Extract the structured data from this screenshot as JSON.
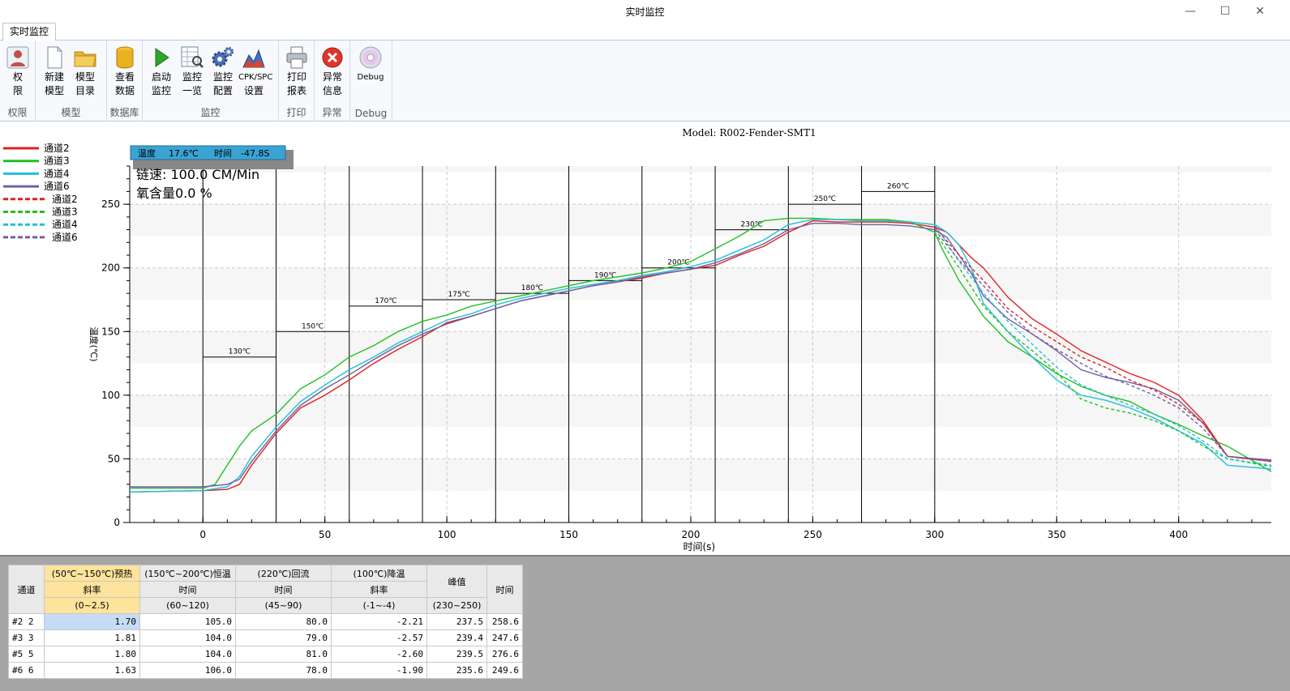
{
  "window": {
    "title": "实时监控",
    "min": "—",
    "max": "☐",
    "close": "✕"
  },
  "tab": {
    "label": "实时监控"
  },
  "ribbon": {
    "groups": [
      {
        "label": "权限",
        "buttons": [
          {
            "label1": "权",
            "label2": "限",
            "icon": "user-lock-icon"
          }
        ]
      },
      {
        "label": "模型",
        "buttons": [
          {
            "label1": "新建",
            "label2": "模型",
            "icon": "new-file-icon"
          },
          {
            "label1": "模型",
            "label2": "目录",
            "icon": "folder-icon"
          }
        ]
      },
      {
        "label": "数据库",
        "buttons": [
          {
            "label1": "查看",
            "label2": "数据",
            "icon": "database-icon"
          }
        ]
      },
      {
        "label": "监控",
        "buttons": [
          {
            "label1": "启动",
            "label2": "监控",
            "icon": "play-icon"
          },
          {
            "label1": "监控",
            "label2": "一览",
            "icon": "table-search-icon"
          },
          {
            "label1": "监控",
            "label2": "配置",
            "icon": "gears-icon"
          },
          {
            "label1": "CPK/SPC",
            "label2": "设置",
            "icon": "chart-icon"
          }
        ]
      },
      {
        "label": "打印",
        "buttons": [
          {
            "label1": "打印",
            "label2": "报表",
            "icon": "printer-icon"
          }
        ]
      },
      {
        "label": "异常",
        "buttons": [
          {
            "label1": "异常",
            "label2": "信息",
            "icon": "error-icon"
          }
        ]
      },
      {
        "label": "Debug",
        "buttons": [
          {
            "label1": "Debug",
            "label2": "",
            "icon": "disc-icon"
          }
        ]
      }
    ]
  },
  "chart_data": {
    "type": "line",
    "title": "Model: R002-Fender-SMT1",
    "xlabel": "时间(s)",
    "ylabel": "温度(℃)",
    "xlim": [
      -30,
      438
    ],
    "ylim": [
      0,
      280
    ],
    "xticks": [
      0,
      50,
      100,
      150,
      200,
      250,
      300,
      350,
      400
    ],
    "yticks": [
      0,
      50,
      100,
      150,
      200,
      250
    ],
    "grid": true,
    "legend_position": "top-left",
    "cursor_readout": {
      "temp_label": "温度",
      "temp": "17.6℃",
      "time_label": "时间",
      "time": "-47.8S"
    },
    "info": {
      "speed": "链速: 100.0 CM/Min",
      "oxygen": "氧含量0.0 %"
    },
    "zones": [
      {
        "x0": 0,
        "x1": 30,
        "temp": 130,
        "label": "130℃"
      },
      {
        "x0": 30,
        "x1": 60,
        "temp": 150,
        "label": "150℃"
      },
      {
        "x0": 60,
        "x1": 90,
        "temp": 170,
        "label": "170℃"
      },
      {
        "x0": 90,
        "x1": 120,
        "temp": 175,
        "label": "175℃"
      },
      {
        "x0": 120,
        "x1": 150,
        "temp": 180,
        "label": "180℃"
      },
      {
        "x0": 150,
        "x1": 180,
        "temp": 190,
        "label": "190℃"
      },
      {
        "x0": 180,
        "x1": 210,
        "temp": 200,
        "label": "200℃"
      },
      {
        "x0": 210,
        "x1": 240,
        "temp": 230,
        "label": "230℃"
      },
      {
        "x0": 240,
        "x1": 270,
        "temp": 250,
        "label": "250℃"
      },
      {
        "x0": 270,
        "x1": 300,
        "temp": 260,
        "label": "260℃"
      }
    ],
    "series": [
      {
        "name": "通道2",
        "color": "#e02020",
        "dash": false,
        "x": [
          -30,
          0,
          10,
          15,
          20,
          30,
          40,
          50,
          60,
          70,
          80,
          90,
          100,
          110,
          120,
          130,
          140,
          150,
          160,
          170,
          180,
          190,
          200,
          210,
          220,
          230,
          240,
          250,
          260,
          270,
          280,
          290,
          300,
          305,
          310,
          315,
          320,
          330,
          340,
          350,
          360,
          370,
          380,
          390,
          400,
          410,
          420,
          438
        ],
        "y": [
          24,
          25,
          26,
          30,
          45,
          70,
          90,
          100,
          112,
          125,
          136,
          146,
          157,
          162,
          168,
          174,
          178,
          182,
          186,
          189,
          192,
          196,
          199,
          202,
          210,
          217,
          228,
          237,
          236,
          236,
          236,
          235,
          232,
          228,
          218,
          208,
          200,
          177,
          160,
          148,
          135,
          126,
          117,
          110,
          100,
          80,
          52,
          48
        ]
      },
      {
        "name": "通道3",
        "color": "#22c022",
        "dash": false,
        "x": [
          -30,
          0,
          5,
          10,
          15,
          20,
          30,
          40,
          50,
          60,
          70,
          80,
          90,
          100,
          110,
          120,
          130,
          140,
          150,
          160,
          170,
          180,
          190,
          200,
          210,
          220,
          230,
          240,
          250,
          260,
          270,
          280,
          290,
          300,
          303,
          310,
          320,
          330,
          340,
          350,
          360,
          370,
          380,
          390,
          400,
          410,
          420,
          438
        ],
        "y": [
          27,
          27,
          30,
          45,
          60,
          72,
          85,
          105,
          116,
          130,
          139,
          150,
          158,
          163,
          170,
          174,
          178,
          182,
          186,
          190,
          193,
          196,
          200,
          205,
          215,
          225,
          237,
          239,
          239,
          238,
          238,
          238,
          236,
          228,
          215,
          190,
          162,
          142,
          130,
          117,
          107,
          100,
          95,
          85,
          77,
          68,
          60,
          40
        ]
      },
      {
        "name": "通道4",
        "color": "#20c0d8",
        "dash": false,
        "x": [
          -30,
          0,
          10,
          15,
          20,
          30,
          40,
          50,
          60,
          70,
          80,
          90,
          100,
          110,
          120,
          130,
          140,
          150,
          160,
          170,
          180,
          190,
          200,
          210,
          220,
          230,
          240,
          250,
          260,
          270,
          280,
          290,
          300,
          305,
          310,
          315,
          320,
          330,
          340,
          350,
          360,
          370,
          380,
          390,
          400,
          410,
          420,
          438
        ],
        "y": [
          24,
          25,
          28,
          36,
          52,
          75,
          95,
          108,
          120,
          130,
          141,
          150,
          159,
          164,
          171,
          176,
          180,
          184,
          187,
          190,
          194,
          197,
          201,
          206,
          214,
          222,
          234,
          238,
          238,
          237,
          237,
          236,
          234,
          228,
          218,
          200,
          172,
          150,
          130,
          112,
          100,
          96,
          90,
          82,
          72,
          62,
          45,
          42
        ]
      },
      {
        "name": "通道6",
        "color": "#7060a0",
        "dash": false,
        "x": [
          -30,
          0,
          10,
          15,
          20,
          30,
          40,
          50,
          60,
          70,
          80,
          90,
          100,
          110,
          120,
          130,
          140,
          150,
          160,
          170,
          180,
          190,
          200,
          210,
          220,
          230,
          240,
          250,
          260,
          270,
          280,
          290,
          300,
          305,
          310,
          315,
          320,
          330,
          340,
          350,
          360,
          370,
          380,
          390,
          400,
          410,
          420,
          438
        ],
        "y": [
          28,
          28,
          30,
          34,
          48,
          72,
          92,
          105,
          116,
          128,
          139,
          148,
          156,
          162,
          168,
          174,
          178,
          182,
          186,
          189,
          193,
          196,
          199,
          204,
          211,
          219,
          230,
          235,
          235,
          234,
          234,
          233,
          230,
          224,
          210,
          196,
          178,
          160,
          148,
          135,
          120,
          114,
          110,
          105,
          96,
          78,
          52,
          49
        ]
      },
      {
        "name": "通道2",
        "color": "#e02020",
        "dash": true,
        "x": [
          300,
          310,
          320,
          330,
          340,
          350,
          360,
          370,
          380,
          390,
          400,
          410,
          420,
          438
        ],
        "y": [
          232,
          210,
          190,
          168,
          154,
          142,
          130,
          122,
          112,
          104,
          93,
          78,
          52,
          48
        ]
      },
      {
        "name": "通道3",
        "color": "#22c022",
        "dash": true,
        "x": [
          300,
          310,
          320,
          330,
          340,
          350,
          360,
          370,
          380,
          390,
          400,
          410,
          420,
          438
        ],
        "y": [
          228,
          200,
          170,
          150,
          135,
          118,
          97,
          90,
          86,
          80,
          72,
          60,
          50,
          44
        ]
      },
      {
        "name": "通道4",
        "color": "#20c0d8",
        "dash": true,
        "x": [
          300,
          310,
          320,
          330,
          340,
          350,
          360,
          370,
          380,
          390,
          400,
          410,
          420,
          438
        ],
        "y": [
          234,
          205,
          180,
          158,
          140,
          122,
          108,
          100,
          92,
          85,
          76,
          64,
          50,
          45
        ]
      },
      {
        "name": "通道6",
        "color": "#7060a0",
        "dash": true,
        "x": [
          300,
          310,
          320,
          330,
          340,
          350,
          360,
          370,
          380,
          390,
          400,
          410,
          420,
          438
        ],
        "y": [
          230,
          206,
          186,
          165,
          148,
          136,
          125,
          115,
          108,
          100,
          90,
          74,
          52,
          48
        ]
      }
    ]
  },
  "table": {
    "header_row1": [
      {
        "text": "通道",
        "rowspan": 3,
        "sel": false
      },
      {
        "text": "(50℃~150℃)预热",
        "rowspan": 1,
        "sel": true
      },
      {
        "text": "(150℃~200℃)恒温",
        "rowspan": 1,
        "sel": false
      },
      {
        "text": "(220℃)回流",
        "rowspan": 1,
        "sel": false
      },
      {
        "text": "(100℃)降温",
        "rowspan": 1,
        "sel": false
      },
      {
        "text": "峰值",
        "rowspan": 2,
        "sel": false
      },
      {
        "text": "时间",
        "rowspan": 3,
        "sel": false
      }
    ],
    "header_row2": [
      {
        "text": "斜率",
        "sel": true
      },
      {
        "text": "时间",
        "sel": false
      },
      {
        "text": "时间",
        "sel": false
      },
      {
        "text": "斜率",
        "sel": false
      }
    ],
    "header_row3": [
      {
        "text": "(0~2.5)",
        "sel": true
      },
      {
        "text": "(60~120)",
        "sel": false
      },
      {
        "text": "(45~90)",
        "sel": false
      },
      {
        "text": "(-1~-4)",
        "sel": false
      },
      {
        "text": "(230~250)",
        "sel": false
      }
    ],
    "rows": [
      [
        "#2 2",
        "1.70",
        "105.0",
        "80.0",
        "-2.21",
        "237.5",
        "258.6"
      ],
      [
        "#3 3",
        "1.81",
        "104.0",
        "79.0",
        "-2.57",
        "239.4",
        "247.6"
      ],
      [
        "#5 5",
        "1.80",
        "104.0",
        "81.0",
        "-2.60",
        "239.5",
        "276.6"
      ],
      [
        "#6 6",
        "1.63",
        "106.0",
        "78.0",
        "-1.90",
        "235.6",
        "249.6"
      ]
    ]
  }
}
